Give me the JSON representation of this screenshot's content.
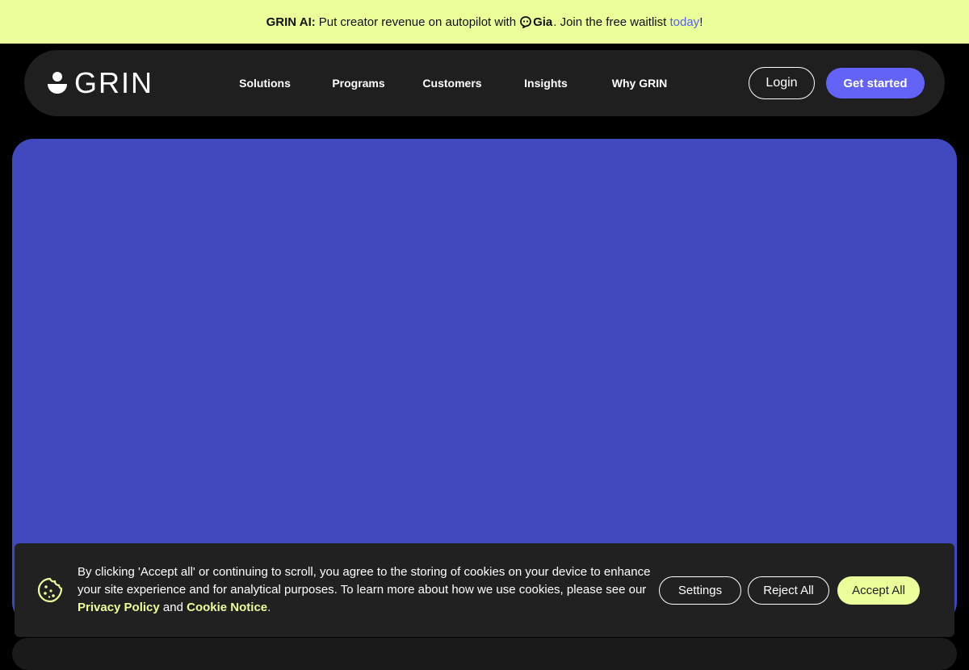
{
  "announcement": {
    "brand": "GRIN AI:",
    "text_before": "Put creator revenue on autopilot with",
    "gia_name": "Gia",
    "text_after": ". Join the free waitlist",
    "link": "today",
    "text_end": "!"
  },
  "nav": {
    "logo_text": "GRIN",
    "items": [
      {
        "label": "Solutions"
      },
      {
        "label": "Programs"
      },
      {
        "label": "Customers"
      },
      {
        "label": "Insights"
      },
      {
        "label": "Why GRIN"
      }
    ],
    "login_label": "Login",
    "cta_label": "Get started"
  },
  "cookie_banner": {
    "icon": "cookie-icon",
    "text": "By clicking 'Accept all' or continuing to scroll, you agree to the storing of cookies on your device to enhance your site experience and for analytical purposes. To learn more about how we use cookies, please see our",
    "privacy_link": "Privacy Policy",
    "and_text": "and",
    "notice_link": "Cookie Notice",
    "end_text": ".",
    "settings_label": "Settings",
    "reject_label": "Reject All",
    "accept_label": "Accept All"
  },
  "colors": {
    "announce_bg": "#eaff9a",
    "nav_bg": "#1f1f1f",
    "hero_bg": "#4049be",
    "cta_bg": "#6463f7",
    "accent_lime": "#eaff9a"
  }
}
